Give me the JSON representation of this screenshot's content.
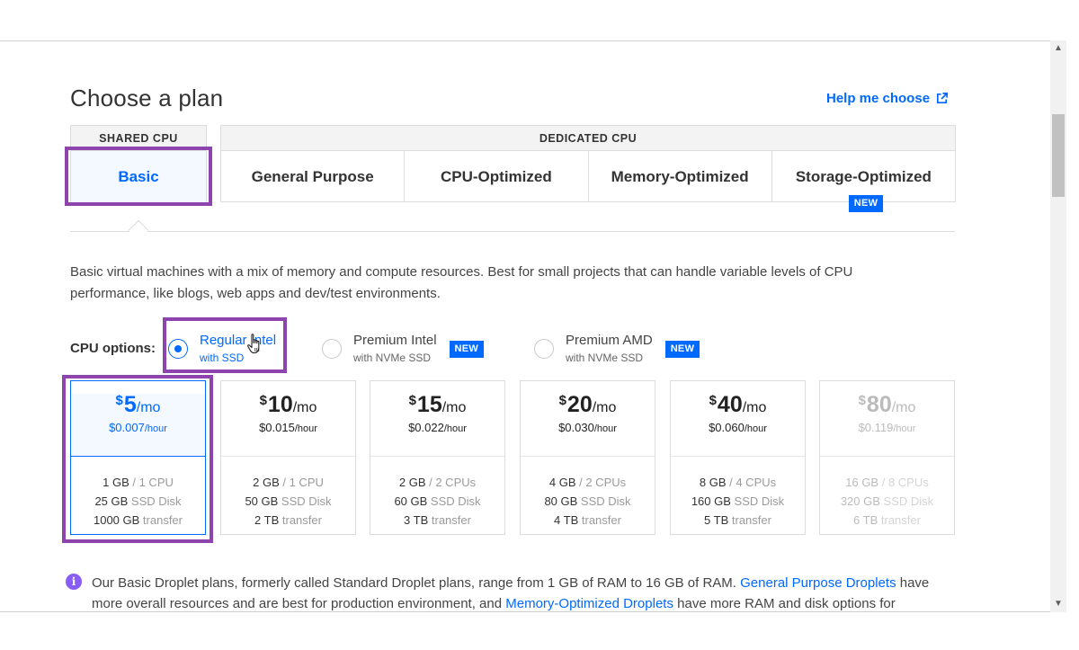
{
  "page": {
    "title": "Choose a plan",
    "help_link": "Help me choose"
  },
  "tabs": {
    "shared_header": "SHARED CPU",
    "dedicated_header": "DEDICATED CPU",
    "basic": "Basic",
    "dedicated": [
      {
        "label": "General Purpose"
      },
      {
        "label": "CPU-Optimized"
      },
      {
        "label": "Memory-Optimized"
      },
      {
        "label": "Storage-Optimized",
        "badge": "NEW"
      }
    ]
  },
  "description": "Basic virtual machines with a mix of memory and compute resources. Best for small projects that can handle variable levels of CPU performance, like blogs, web apps and dev/test environments.",
  "cpu_options": {
    "label": "CPU options:",
    "options": [
      {
        "main": "Regular Intel",
        "sub": "with SSD",
        "selected": true
      },
      {
        "main": "Premium Intel",
        "sub": "with NVMe SSD",
        "badge": "NEW"
      },
      {
        "main": "Premium AMD",
        "sub": "with NVMe SSD",
        "badge": "NEW"
      }
    ]
  },
  "plans": [
    {
      "currency": "$",
      "price": "5",
      "per": "/mo",
      "hourly": "$0.007",
      "hourly_unit": "/hour",
      "mem": "1 GB",
      "cpu": " / 1 CPU",
      "disk": "25 GB",
      "disk_unit": " SSD Disk",
      "transfer": "1000 GB",
      "transfer_unit": " transfer",
      "state": "selected"
    },
    {
      "currency": "$",
      "price": "10",
      "per": "/mo",
      "hourly": "$0.015",
      "hourly_unit": "/hour",
      "mem": "2 GB",
      "cpu": " / 1 CPU",
      "disk": "50 GB",
      "disk_unit": " SSD Disk",
      "transfer": "2 TB",
      "transfer_unit": " transfer",
      "state": "normal"
    },
    {
      "currency": "$",
      "price": "15",
      "per": "/mo",
      "hourly": "$0.022",
      "hourly_unit": "/hour",
      "mem": "2 GB",
      "cpu": " / 2 CPUs",
      "disk": "60 GB",
      "disk_unit": " SSD Disk",
      "transfer": "3 TB",
      "transfer_unit": " transfer",
      "state": "normal"
    },
    {
      "currency": "$",
      "price": "20",
      "per": "/mo",
      "hourly": "$0.030",
      "hourly_unit": "/hour",
      "mem": "4 GB",
      "cpu": " / 2 CPUs",
      "disk": "80 GB",
      "disk_unit": " SSD Disk",
      "transfer": "4 TB",
      "transfer_unit": " transfer",
      "state": "normal"
    },
    {
      "currency": "$",
      "price": "40",
      "per": "/mo",
      "hourly": "$0.060",
      "hourly_unit": "/hour",
      "mem": "8 GB",
      "cpu": " / 4 CPUs",
      "disk": "160 GB",
      "disk_unit": " SSD Disk",
      "transfer": "5 TB",
      "transfer_unit": " transfer",
      "state": "normal"
    },
    {
      "currency": "$",
      "price": "80",
      "per": "/mo",
      "hourly": "$0.119",
      "hourly_unit": "/hour",
      "mem": "16 GB",
      "cpu": " / 8 CPUs",
      "disk": "320 GB",
      "disk_unit": " SSD Disk",
      "transfer": "6 TB",
      "transfer_unit": " transfer",
      "state": "disabled"
    }
  ],
  "info": {
    "text_1": "Our Basic Droplet plans, formerly called Standard Droplet plans, range from 1 GB of RAM to 16 GB of RAM. ",
    "link_1": "General Purpose Droplets",
    "text_2": " have more overall resources and are best for production environment, and ",
    "link_2": "Memory-Optimized Droplets",
    "text_3": " have more RAM and disk options for"
  },
  "colors": {
    "accent": "#0069ff",
    "highlight": "#8e44ad",
    "info_icon": "#8a5cf6"
  },
  "icons": {
    "help": "external-link-icon",
    "info": "info-circle-icon",
    "cursor": "hand-pointer-icon"
  }
}
